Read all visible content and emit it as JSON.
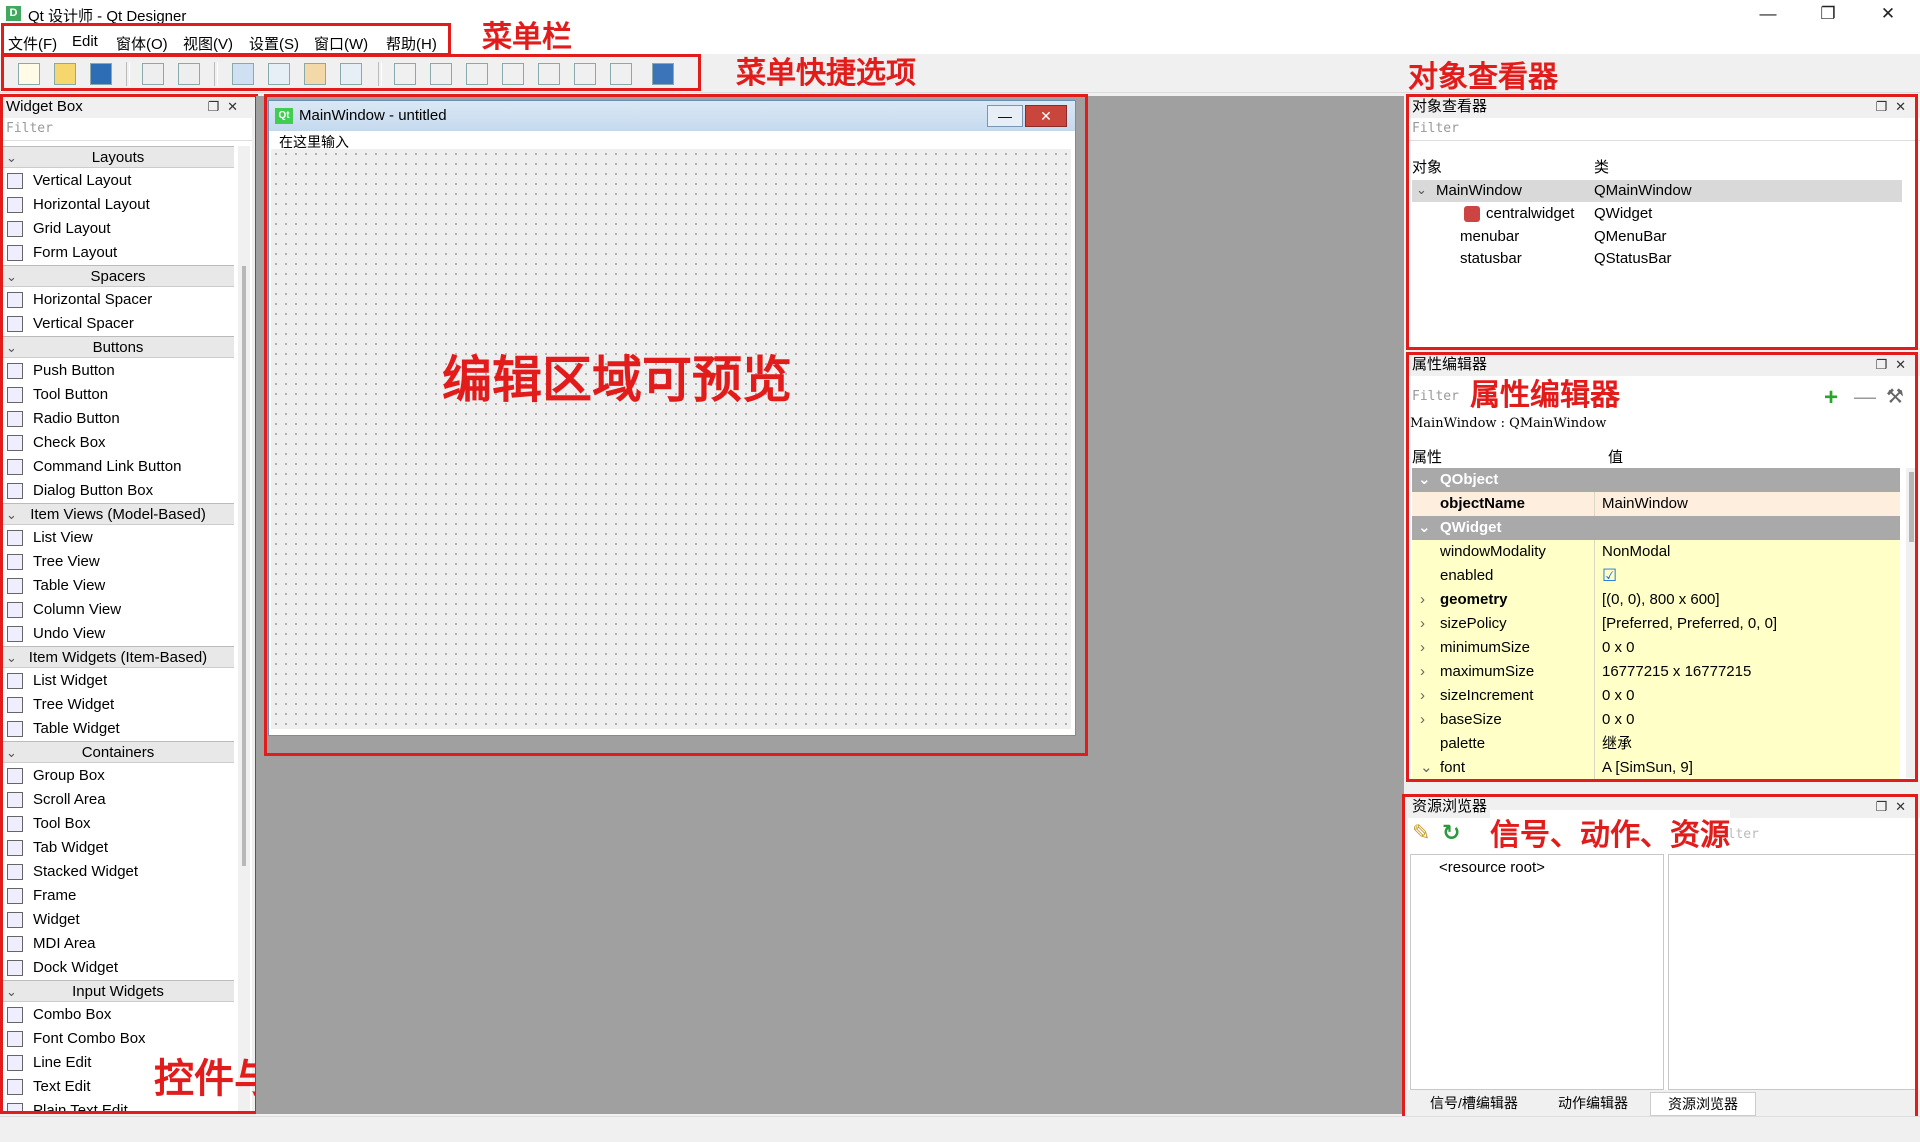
{
  "window": {
    "title": "Qt 设计师 - Qt Designer",
    "app_icon": "D",
    "controls": [
      "—",
      "❐",
      "✕"
    ]
  },
  "menubar": {
    "items": [
      "文件(F)",
      "Edit",
      "窗体(O)",
      "视图(V)",
      "设置(S)",
      "窗口(W)",
      "帮助(H)"
    ]
  },
  "toolbar": {
    "icons": [
      "new-file-icon",
      "open-folder-icon",
      "save-icon",
      "copy-icon",
      "paste-icon",
      "edit-widgets-icon",
      "edit-signals-slots-icon",
      "edit-buddies-icon",
      "edit-tab-order-icon",
      "layout-horizontal-icon",
      "layout-vertical-icon",
      "layout-horizontal-splitter-icon",
      "layout-vertical-splitter-icon",
      "layout-grid-icon",
      "layout-form-icon",
      "break-layout-icon",
      "adjust-size-icon"
    ]
  },
  "annotations": {
    "menubar": "菜单栏",
    "toolbar": "菜单快捷选项",
    "object_inspector": "对象查看器",
    "editor": "编辑区域可预览",
    "property_editor": "属性编辑器",
    "resources": "信号、动作、资源",
    "widget_box": "控件与布局"
  },
  "widget_box": {
    "title": "Widget Box",
    "filter_placeholder": "Filter",
    "categories": [
      {
        "name": "Layouts",
        "items": [
          "Vertical Layout",
          "Horizontal Layout",
          "Grid Layout",
          "Form Layout"
        ]
      },
      {
        "name": "Spacers",
        "items": [
          "Horizontal Spacer",
          "Vertical Spacer"
        ]
      },
      {
        "name": "Buttons",
        "items": [
          "Push Button",
          "Tool Button",
          "Radio Button",
          "Check Box",
          "Command Link Button",
          "Dialog Button Box"
        ]
      },
      {
        "name": "Item Views (Model-Based)",
        "items": [
          "List View",
          "Tree View",
          "Table View",
          "Column View",
          "Undo View"
        ]
      },
      {
        "name": "Item Widgets (Item-Based)",
        "items": [
          "List Widget",
          "Tree Widget",
          "Table Widget"
        ]
      },
      {
        "name": "Containers",
        "items": [
          "Group Box",
          "Scroll Area",
          "Tool Box",
          "Tab Widget",
          "Stacked Widget",
          "Frame",
          "Widget",
          "MDI Area",
          "Dock Widget"
        ]
      },
      {
        "name": "Input Widgets",
        "items": [
          "Combo Box",
          "Font Combo Box",
          "Line Edit",
          "Text Edit",
          "Plain Text Edit"
        ]
      }
    ]
  },
  "form": {
    "title": "MainWindow - untitled",
    "title_icon": "Qt",
    "menu_placeholder": "在这里输入"
  },
  "object_inspector": {
    "title": "对象查看器",
    "filter_placeholder": "Filter",
    "col_object": "对象",
    "col_class": "类",
    "rows": [
      {
        "object": "MainWindow",
        "class": "QMainWindow"
      },
      {
        "object": "centralwidget",
        "class": "QWidget"
      },
      {
        "object": "menubar",
        "class": "QMenuBar"
      },
      {
        "object": "statusbar",
        "class": "QStatusBar"
      }
    ]
  },
  "property_editor": {
    "title": "属性编辑器",
    "filter_placeholder": "Filter",
    "context": "MainWindow : QMainWindow",
    "col_property": "属性",
    "col_value": "值",
    "rows": [
      {
        "kind": "group",
        "name": "QObject",
        "value": ""
      },
      {
        "kind": "prop",
        "name": "objectName",
        "value": "MainWindow",
        "bold": true
      },
      {
        "kind": "group",
        "name": "QWidget",
        "value": ""
      },
      {
        "kind": "prop",
        "name": "windowModality",
        "value": "NonModal"
      },
      {
        "kind": "prop",
        "name": "enabled",
        "value": "☑"
      },
      {
        "kind": "prop",
        "name": "geometry",
        "value": "[(0, 0), 800 x 600]",
        "bold": true,
        "expand": "›"
      },
      {
        "kind": "prop",
        "name": "sizePolicy",
        "value": "[Preferred, Preferred, 0, 0]",
        "expand": "›"
      },
      {
        "kind": "prop",
        "name": "minimumSize",
        "value": "0 x 0",
        "expand": "›"
      },
      {
        "kind": "prop",
        "name": "maximumSize",
        "value": "16777215 x 16777215",
        "expand": "›"
      },
      {
        "kind": "prop",
        "name": "sizeIncrement",
        "value": "0 x 0",
        "expand": "›"
      },
      {
        "kind": "prop",
        "name": "baseSize",
        "value": "0 x 0",
        "expand": "›"
      },
      {
        "kind": "prop",
        "name": "palette",
        "value": "继承"
      },
      {
        "kind": "prop",
        "name": "font",
        "value": "A  [SimSun, 9]",
        "expand": "⌄"
      }
    ]
  },
  "resource_browser": {
    "title": "资源浏览器",
    "filter_placeholder": "Filter",
    "root": "<resource root>",
    "tabs": [
      "信号/槽编辑器",
      "动作编辑器",
      "资源浏览器"
    ]
  },
  "colors": {
    "annotation": "#e21b1b",
    "group_bg": "#a9a9a9",
    "prop_bg": "#ffffc8"
  }
}
